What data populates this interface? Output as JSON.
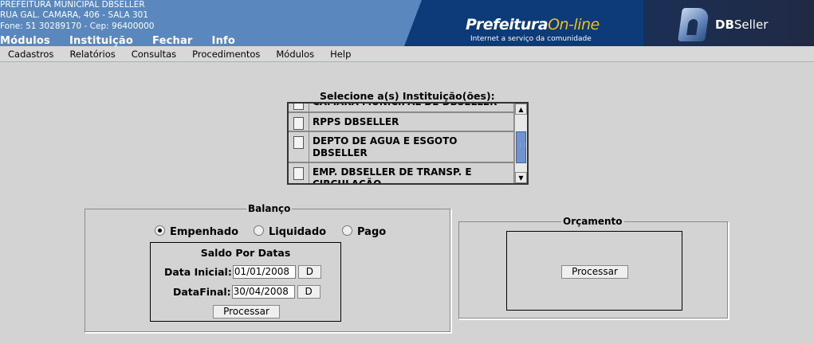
{
  "header": {
    "address_lines": [
      "PREFEITURA MUNICIPAL DBSELLER",
      "RUA GAL. CAMARA, 406 - SALA 301",
      "Fone: 51 30289170  -  Cep: 96400000"
    ],
    "top_nav": [
      "Módulos",
      "Instituição",
      "Fechar",
      "Info"
    ],
    "brand": {
      "name_main": "Prefeitura",
      "name_accent": "On-line",
      "tagline": "Internet a serviço da comunidade"
    },
    "vendor_logo": {
      "bold": "DB",
      "rest": "Seller"
    },
    "colors": {
      "header_bg": "#5b87bf",
      "brand_bg": "#0d3a78",
      "accent": "#f0c020"
    }
  },
  "menubar": [
    "Cadastros",
    "Relatórios",
    "Consultas",
    "Procedimentos",
    "Módulos",
    "Help"
  ],
  "institutions": {
    "label": "Selecione a(s) Instituição(ões):",
    "items": [
      {
        "label": "CAMARA MUNICIPAL DE DBSELLER",
        "checked": false
      },
      {
        "label": "RPPS DBSELLER",
        "checked": false
      },
      {
        "label": "DEPTO DE AGUA E ESGOTO DBSELLER",
        "checked": false
      },
      {
        "label": "EMP. DBSELLER DE TRANSP. E CIRCULAÇÃO",
        "checked": false
      }
    ]
  },
  "balanco": {
    "legend": "Balanço",
    "options": [
      {
        "label": "Empenhado",
        "selected": true
      },
      {
        "label": "Liquidado",
        "selected": false
      },
      {
        "label": "Pago",
        "selected": false
      }
    ],
    "saldo": {
      "title": "Saldo Por Datas",
      "data_inicial_label": "Data Inicial:",
      "data_inicial_value": "01/01/2008",
      "data_final_label": "DataFinal:",
      "data_final_value": "30/04/2008",
      "date_button": "D",
      "process_button": "Processar"
    }
  },
  "orcamento": {
    "legend": "Orçamento",
    "process_button": "Processar"
  }
}
